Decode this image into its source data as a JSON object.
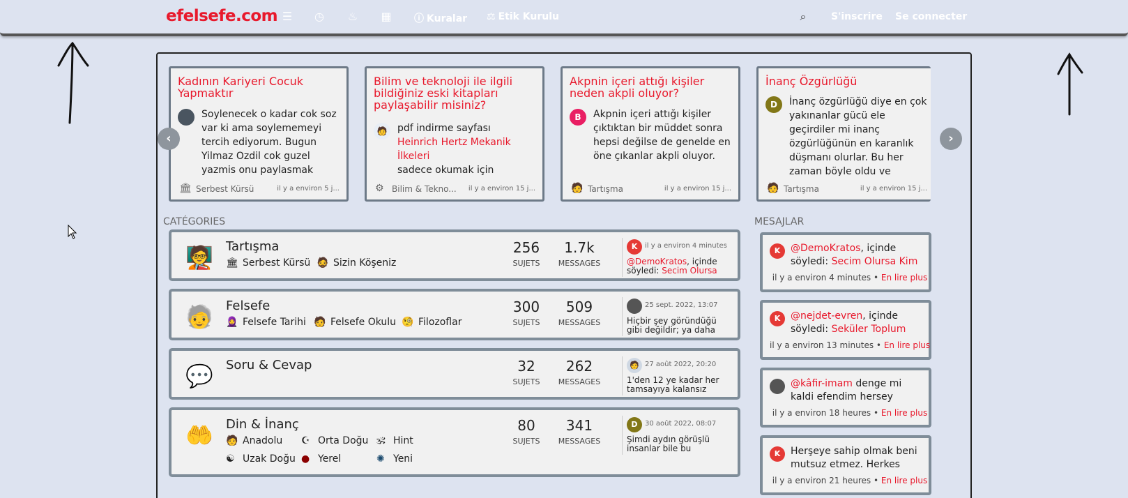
{
  "nav": {
    "brand": "efelsefe.com",
    "links": [
      {
        "icon": "list-icon",
        "glyph": "☰"
      },
      {
        "icon": "clock-icon",
        "glyph": "◷"
      },
      {
        "icon": "fire-icon",
        "glyph": "🜂"
      },
      {
        "icon": "map-icon",
        "glyph": "▦"
      }
    ],
    "rules": "Kuralar",
    "ethics": "Etik Kurulu",
    "register": "S'inscrire",
    "login": "Se connecter"
  },
  "carousel": [
    {
      "title": "Kadının Kariyeri Cocuk Yapmaktır",
      "avatar_letter": "",
      "avatar_color": "#4a5560",
      "body": "Soylenecek o kadar cok soz var ki ama soylememeyi tercih ediyorum. Bugun Yilmaz Ozdil cok guzel yazmis onu paylasmak",
      "category": "Serbest Kürsü",
      "time": "il y a environ 5 j..."
    },
    {
      "title": "Bilim ve teknoloji ile ilgili bildiğiniz eski kitapları paylaşabilir misiniz?",
      "avatar_letter": "",
      "avatar_color": "#e8eef5",
      "body_prefix": "pdf indirme sayfası",
      "body_link": "Heinrich Hertz Mekanik İlkeleri",
      "body_suffix": "sadece okumak için",
      "category": "Bilim & Tekno...",
      "time": "il y a environ 15 j..."
    },
    {
      "title": "Akpnin içeri attığı kişiler neden akpli oluyor?",
      "avatar_letter": "B",
      "avatar_color": "#e91e63",
      "body": "Akpnin içeri attığı kişiler çıktıktan bir müddet sonra hepsi değilse de genelde en öne çıkanlar akpli oluyor.",
      "category": "Tartışma",
      "time": "il y a environ 15 j..."
    },
    {
      "title": "İnanç Özgürlüğü",
      "avatar_letter": "D",
      "avatar_color": "#827717",
      "body": "İnanç özgürlüğü diye en çok yakınanlar gücü ele geçirdiler mi inanç özgürlüğünün en karanlık düşmanı olurlar. Bu her zaman böyle oldu ve",
      "category": "Tartışma",
      "time": "il y a environ 15 j..."
    }
  ],
  "categories_heading": "CATÉGORIES",
  "messages_heading": "MESAJLAR",
  "categories": [
    {
      "name": "Tartışma",
      "icon": "debate-icon",
      "glyph": "🧑‍🏫",
      "subcats": [
        {
          "name": "Serbest Kürsü",
          "glyph": "🏛"
        },
        {
          "name": "Sizin Köşeniz",
          "glyph": "🧔"
        }
      ],
      "topics": "256",
      "messages": "1.7k",
      "last_avatar": "K",
      "last_color": "#e53935",
      "last_time": "il y a environ 4 minutes",
      "last_user": "@DemoKratos",
      "last_text": ", içinde söyledi: ",
      "last_link": "Secim Olursa"
    },
    {
      "name": "Felsefe",
      "icon": "philosopher-icon",
      "glyph": "🧓",
      "subcats": [
        {
          "name": "Felsefe Tarihi",
          "glyph": "🧕"
        },
        {
          "name": "Felsefe Okulu",
          "glyph": "🧑‍🎓"
        },
        {
          "name": "Filozoflar",
          "glyph": "🧐"
        }
      ],
      "topics": "300",
      "messages": "509",
      "last_avatar": "",
      "last_color": "#555",
      "last_time": "25 sept. 2022, 13:07",
      "last_user": "",
      "last_text": "Hiçbir şey göründüğü gibi değildir; ya daha",
      "last_link": ""
    },
    {
      "name": "Soru & Cevap",
      "icon": "qa-icon",
      "glyph": "💬",
      "subcats": [],
      "topics": "32",
      "messages": "262",
      "last_avatar": "",
      "last_color": "#cfd8e3",
      "last_time": "27 août 2022, 20:20",
      "last_user": "",
      "last_text": "1'den 12 ye kadar her tamsayıya kalansız",
      "last_link": ""
    },
    {
      "name": "Din & İnanç",
      "icon": "faith-icon",
      "glyph": "🤲",
      "subcats": [
        {
          "name": "Anadolu",
          "glyph": "🧑"
        },
        {
          "name": "Orta Doğu",
          "glyph": "☪"
        },
        {
          "name": "Hint",
          "glyph": "🕉"
        },
        {
          "name": "Uzak Doğu",
          "glyph": "☯"
        },
        {
          "name": "Yerel",
          "glyph": "●"
        },
        {
          "name": "Yeni",
          "glyph": "✺"
        }
      ],
      "topics": "80",
      "messages": "341",
      "last_avatar": "D",
      "last_color": "#827717",
      "last_time": "30 août 2022, 08:07",
      "last_user": "",
      "last_text": "Şimdi aydın görüşlü insanlar bile bu",
      "last_link": ""
    }
  ],
  "stat_labels": {
    "topics": "SUJETS",
    "messages": "MESSAGES"
  },
  "messages": [
    {
      "avatar": "K",
      "color": "#e53935",
      "user": "@DemoKratos",
      "text": ", içinde söyledi: ",
      "link": "Secim Olursa Kim",
      "time": "il y a environ 4 minutes",
      "more": "En lire plus"
    },
    {
      "avatar": "K",
      "color": "#e53935",
      "user": "@nejdet-evren",
      "text": ", içinde söyledi: ",
      "link": "Seküler Toplum",
      "time": "il y a environ 13 minutes",
      "more": "En lire plus"
    },
    {
      "avatar": "",
      "color": "#555",
      "user": "@kâfir-imam",
      "text": " denge mi kaldi efendim hersey",
      "link": "",
      "time": "il y a environ 18 heures",
      "more": "En lire plus"
    },
    {
      "avatar": "K",
      "color": "#e53935",
      "user": "",
      "text": "Herşeye sahip olmak beni mutsuz etmez. Herkes",
      "link": "",
      "time": "il y a environ 21 heures",
      "more": "En lire plus"
    }
  ]
}
